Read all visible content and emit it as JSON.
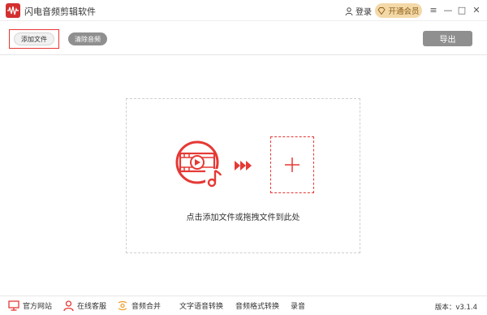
{
  "window": {
    "title": "闪电音频剪辑软件",
    "login_label": "登录",
    "vip_label": "开通会员",
    "controls": [
      "≡",
      "—",
      "□",
      "✕"
    ]
  },
  "toolbar": {
    "add_file_label": "添加文件",
    "clear_audio_label": "清除音频",
    "export_label": "导出"
  },
  "main": {
    "drop_hint": "点击添加文件或拖拽文件到此处",
    "add_icon": "plus-icon",
    "media_icon": "video-audio-icon"
  },
  "bottom": {
    "items": [
      {
        "label": "官方网站",
        "icon": "monitor-icon"
      },
      {
        "label": "在线客服",
        "icon": "user-service-icon"
      },
      {
        "label": "音频合并",
        "icon": "merge-icon"
      },
      {
        "label": "文字语音转换",
        "icon": ""
      },
      {
        "label": "音频格式转换",
        "icon": ""
      },
      {
        "label": "录音",
        "icon": ""
      }
    ],
    "version": "版本：v3.1.4"
  },
  "colors": {
    "accent": "#e53935",
    "gray_button": "#8f8f8f",
    "vip_bg": "#f3d9a8"
  }
}
